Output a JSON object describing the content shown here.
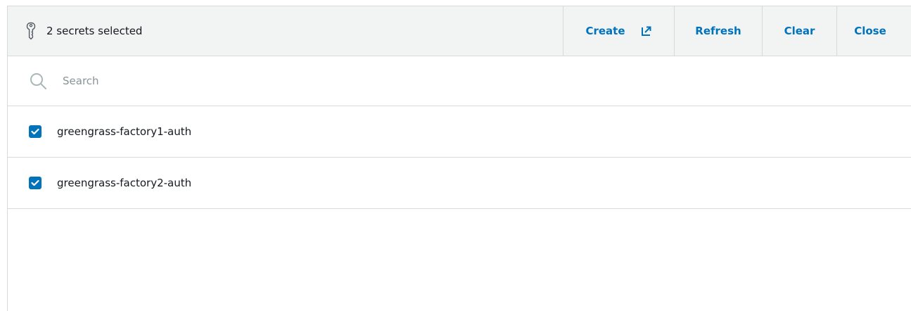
{
  "header": {
    "selected_text": "2 secrets selected",
    "actions": {
      "create": "Create",
      "refresh": "Refresh",
      "clear": "Clear",
      "close": "Close"
    }
  },
  "search": {
    "placeholder": "Search",
    "value": ""
  },
  "items": [
    {
      "label": "greengrass-factory1-auth",
      "checked": true
    },
    {
      "label": "greengrass-factory2-auth",
      "checked": true
    }
  ],
  "colors": {
    "accent": "#0073bb",
    "header_bg": "#f2f3f3",
    "border": "#d5dbdb",
    "text": "#16191f",
    "placeholder": "#879596"
  },
  "icons": {
    "header": "key-icon",
    "create": "external-link-icon",
    "search": "search-icon",
    "checkbox": "checkmark-icon"
  }
}
